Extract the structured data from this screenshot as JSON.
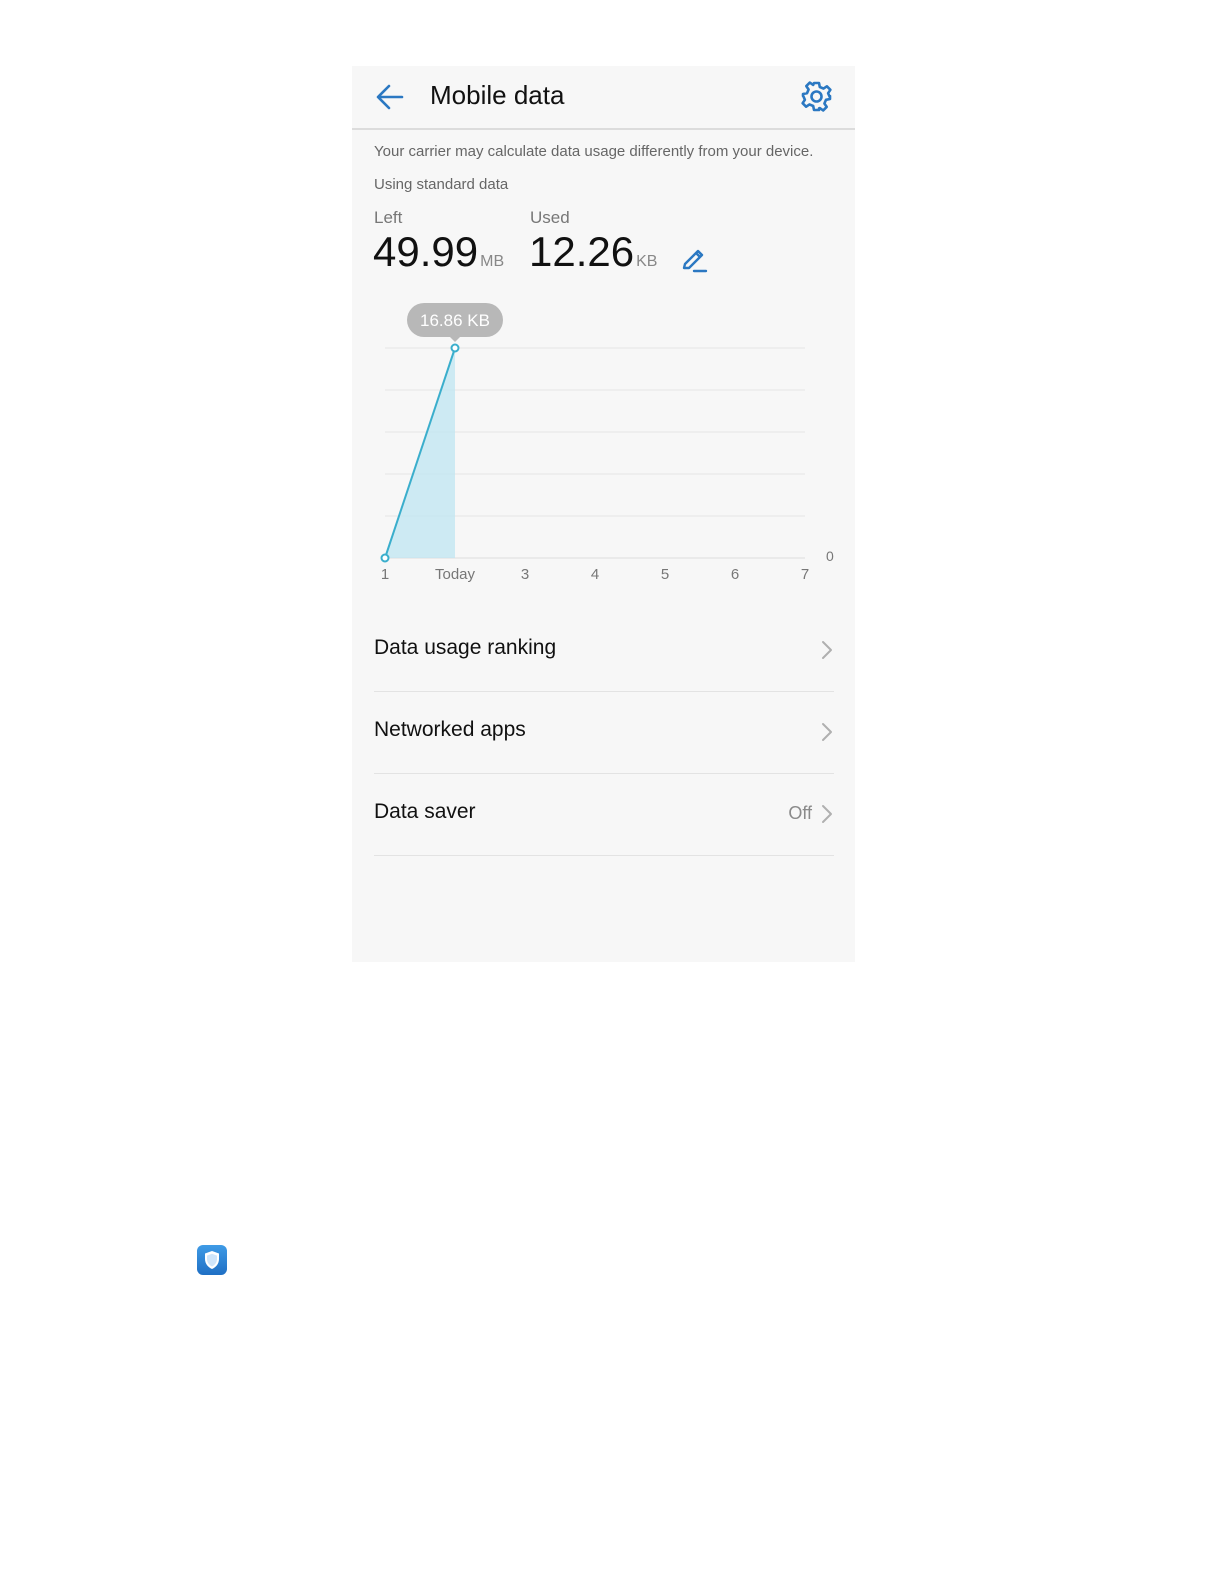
{
  "header": {
    "title": "Mobile data",
    "back_icon": "back-arrow-icon",
    "settings_icon": "gear-icon"
  },
  "notice": "Your carrier may calculate data usage differently from your device.",
  "plan_label": "Using standard data",
  "usage": {
    "left_label": "Left",
    "left_value": "49.99",
    "left_unit": "MB",
    "used_label": "Used",
    "used_value": "12.26",
    "used_unit": "KB",
    "edit_icon": "pencil-icon"
  },
  "chart_data": {
    "type": "area",
    "categories": [
      "1",
      "Today",
      "3",
      "4",
      "5",
      "6",
      "7"
    ],
    "values": [
      0,
      16.86
    ],
    "highlight": {
      "category": "Today",
      "label": "16.86 KB"
    },
    "y_axis_label": "0",
    "grid": true,
    "colors": {
      "line": "#3aaecc",
      "fill": "#bfe6f2",
      "tooltip_bg": "#b8b8b8"
    }
  },
  "menu": {
    "items": [
      {
        "label": "Data usage ranking",
        "value": ""
      },
      {
        "label": "Networked apps",
        "value": ""
      },
      {
        "label": "Data saver",
        "value": "Off"
      }
    ]
  },
  "footer_icon": "shield-app-icon",
  "colors": {
    "accent": "#2b78c2",
    "text": "#111111",
    "muted": "#777777",
    "background": "#f7f7f7"
  }
}
